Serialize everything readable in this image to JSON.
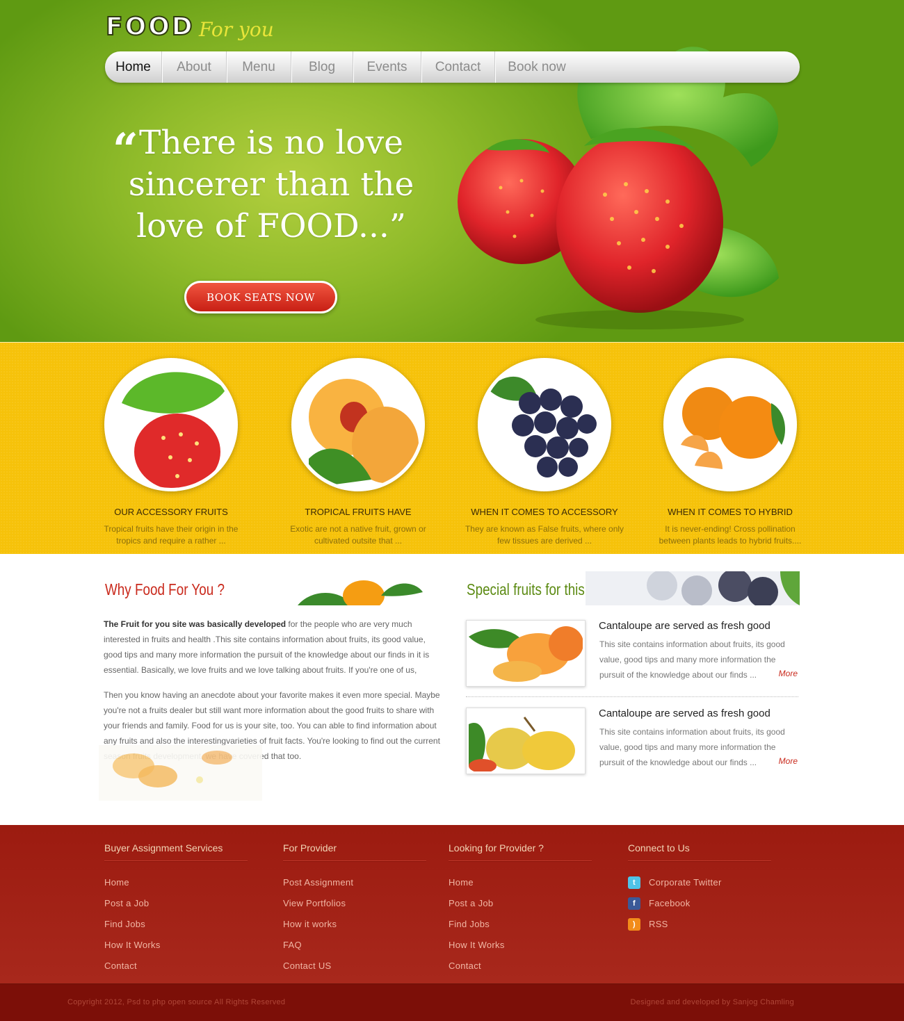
{
  "brand": {
    "name": "FOOD",
    "tagline": "For you"
  },
  "nav": {
    "items": [
      "Home",
      "About",
      "Menu",
      "Blog",
      "Events",
      "Contact",
      "Book now"
    ],
    "active": "Home"
  },
  "hero": {
    "quote_mark": "“",
    "quote": "There is no love sincerer than the love of FOOD...”",
    "cta": "BOOK SEATS NOW"
  },
  "features": [
    {
      "title": "OUR ACCESSORY FRUITS",
      "text": "Tropical fruits have their origin in the tropics and require a rather ..."
    },
    {
      "title": "TROPICAL FRUITS HAVE",
      "text": "Exotic are not a native fruit, grown or cultivated outsite that ..."
    },
    {
      "title": "WHEN IT COMES TO ACCESSORY",
      "text": "They are known as False fruits, where only few tissues are derived ..."
    },
    {
      "title": "WHEN IT COMES TO HYBRID",
      "text": "It is never-ending! Cross pollination between plants leads to hybrid fruits...."
    }
  ],
  "why": {
    "title": "Why Food For  You ?",
    "lead_bold": "The Fruit for you site was basically developed",
    "lead_rest": " for the people who are very much interested in fruits and health .This site contains information about fruits, its good value, good tips and many more information the pursuit of the knowledge about our finds in it is essential. Basically, we love fruits and we love talking about fruits. If you're one of us,",
    "para2": "Then you know having an anecdote about your favorite makes it even more special. Maybe you're not a fruits dealer but still want more information about the good fruits to share with your friends and family. Food for us is your site, too. You can able to find information about any fruits and also the interestingvarieties of fruit facts. You're looking to find out the current season fruits development, we have covered that too."
  },
  "special": {
    "title": "Special fruits for this week",
    "items": [
      {
        "title": "Cantaloupe are served as fresh good",
        "text": "This site contains information about fruits, its good value, good tips and many more information the pursuit of the knowledge about our finds ...",
        "more": "More"
      },
      {
        "title": "Cantaloupe are served as fresh good",
        "text": "This site contains information about fruits, its good value, good tips and many more information the pursuit of the knowledge about our finds ...",
        "more": "More"
      }
    ]
  },
  "footer": {
    "columns": [
      {
        "heading": "Buyer Assignment Services",
        "links": [
          "Home",
          "Post a Job",
          "Find Jobs",
          "How It Works",
          "Contact"
        ]
      },
      {
        "heading": "For Provider",
        "links": [
          "Post Assignment",
          "View Portfolios",
          "How it works",
          "FAQ",
          "Contact US"
        ]
      },
      {
        "heading": "Looking for Provider ?",
        "links": [
          "Home",
          "Post a Job",
          "Find Jobs",
          "How It Works",
          "Contact"
        ]
      },
      {
        "heading": "Connect to Us",
        "links": [
          "Corporate Twitter",
          "Facebook",
          "RSS"
        ],
        "icons": [
          "twitter-icon",
          "facebook-icon",
          "rss-icon"
        ]
      }
    ],
    "copyright": "Copyright 2012, Psd to php open source  All Rights Reserved",
    "designed": "Designed and developed by Sanjog Chamling"
  },
  "colors": {
    "hero_green": "#6aa51a",
    "band_yellow": "#f6c20a",
    "accent_red": "#c9291c",
    "footer_red": "#a1200f",
    "special_green": "#5b8a12"
  }
}
